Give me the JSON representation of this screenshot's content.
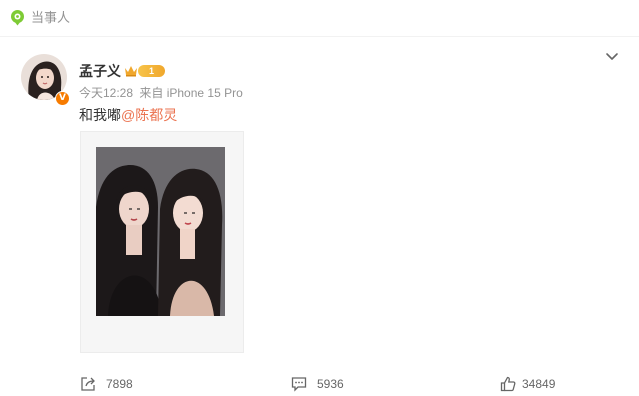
{
  "topic": {
    "label": "当事人",
    "icon": "topic-icon",
    "accent": "#7ecb35"
  },
  "post": {
    "author": "孟子义",
    "verified_badge": "V",
    "level_label": "1",
    "timestamp": "今天12:28",
    "source": "来自 iPhone 15 Pro",
    "text": "和我嘟",
    "mention": "@陈都灵",
    "mention_color": "#eb7350"
  },
  "actions": {
    "repost_count": "7898",
    "comment_count": "5936",
    "like_count": "34849"
  },
  "icons": [
    "chevron-down-icon",
    "crown-icon",
    "repost-icon",
    "comment-icon",
    "like-icon"
  ]
}
